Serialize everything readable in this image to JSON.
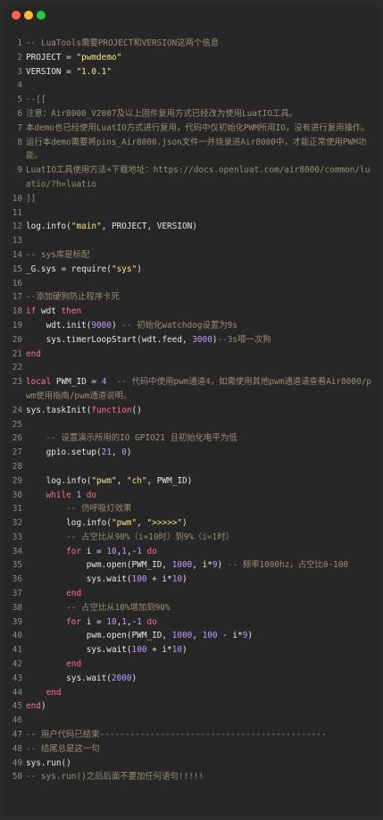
{
  "window": {
    "controls": [
      {
        "name": "close",
        "color": "#ff5f57"
      },
      {
        "name": "minimize",
        "color": "#febc2e"
      },
      {
        "name": "maximize",
        "color": "#28c840"
      }
    ]
  },
  "colors": {
    "keyword": "#ff6e8a",
    "string": "#f1e58a",
    "number": "#bd9cff",
    "comment": "#9a8e72",
    "text": "#e6e6e6",
    "line_number": "#8b8b8b"
  },
  "lines": [
    {
      "n": "1",
      "t": [
        [
          "c",
          "-- LuaTools需要PROJECT和VERSION这两个信息"
        ]
      ]
    },
    {
      "n": "2",
      "t": [
        [
          "",
          "PROJECT = "
        ],
        [
          "s",
          "\"pwmdemo\""
        ]
      ]
    },
    {
      "n": "3",
      "t": [
        [
          "",
          "VERSION = "
        ],
        [
          "s",
          "\"1.0.1\""
        ]
      ]
    },
    {
      "n": "4",
      "t": []
    },
    {
      "n": "5",
      "t": [
        [
          "c",
          "--[["
        ]
      ]
    },
    {
      "n": "6",
      "t": [
        [
          "c",
          "注意：Air8000_V2007及以上固件复用方式已经改为使用LuatIO工具。"
        ]
      ]
    },
    {
      "n": "7",
      "t": [
        [
          "c",
          "本demo也已经使用LuatIO方式进行复用，代码中仅初始化PWM所用IO，没有进行复用操作。"
        ]
      ]
    },
    {
      "n": "8",
      "t": [
        [
          "c",
          "运行本demo需要将pins_Air8000.json文件一并烧录进Air8000中，才能正常使用PWM功能。"
        ]
      ]
    },
    {
      "n": "9",
      "t": [
        [
          "c",
          "LuatIO工具使用方法+下载地址：https://docs.openluat.com/air8000/common/luatio/?h=luatio"
        ]
      ]
    },
    {
      "n": "10",
      "t": [
        [
          "c",
          "]]"
        ]
      ]
    },
    {
      "n": "11",
      "t": []
    },
    {
      "n": "12",
      "t": [
        [
          "",
          "log.info("
        ],
        [
          "s",
          "\"main\""
        ],
        [
          "",
          ", PROJECT, VERSION)"
        ]
      ]
    },
    {
      "n": "13",
      "t": []
    },
    {
      "n": "14",
      "t": [
        [
          "c",
          "-- sys库是标配"
        ]
      ]
    },
    {
      "n": "15",
      "t": [
        [
          "",
          "_G.sys = require("
        ],
        [
          "s",
          "\"sys\""
        ],
        [
          "",
          ")"
        ]
      ]
    },
    {
      "n": "16",
      "t": []
    },
    {
      "n": "17",
      "t": [
        [
          "c",
          "--添加硬狗防止程序卡死"
        ]
      ]
    },
    {
      "n": "18",
      "t": [
        [
          "k",
          "if"
        ],
        [
          "",
          " wdt "
        ],
        [
          "k",
          "then"
        ]
      ]
    },
    {
      "n": "19",
      "t": [
        [
          "",
          "    wdt.init("
        ],
        [
          "n",
          "9000"
        ],
        [
          "",
          ") "
        ],
        [
          "c",
          "-- 初始化watchdog设置为9s"
        ]
      ]
    },
    {
      "n": "20",
      "t": [
        [
          "",
          "    sys.timerLoopStart(wdt.feed, "
        ],
        [
          "n",
          "3000"
        ],
        [
          "",
          ")"
        ],
        [
          "c",
          "--3s喂一次狗"
        ]
      ]
    },
    {
      "n": "21",
      "t": [
        [
          "k",
          "end"
        ]
      ]
    },
    {
      "n": "22",
      "t": []
    },
    {
      "n": "23",
      "t": [
        [
          "k",
          "local"
        ],
        [
          "",
          " PWM_ID = "
        ],
        [
          "n",
          "4"
        ],
        [
          "",
          "  "
        ],
        [
          "c",
          "-- 代码中使用pwm通道4，如需使用其他pwm通道请查看Air8000/pwm使用指南/pwm通道说明。"
        ]
      ]
    },
    {
      "n": "24",
      "t": [
        [
          "",
          "sys.taskInit("
        ],
        [
          "k",
          "function"
        ],
        [
          "",
          "()"
        ]
      ]
    },
    {
      "n": "25",
      "t": []
    },
    {
      "n": "26",
      "t": [
        [
          "",
          "    "
        ],
        [
          "c",
          "-- 设置演示所用的IO GPIO21 且初始化电平为低"
        ]
      ]
    },
    {
      "n": "27",
      "t": [
        [
          "",
          "    gpio.setup("
        ],
        [
          "n",
          "21"
        ],
        [
          "",
          ", "
        ],
        [
          "n",
          "0"
        ],
        [
          "",
          ")"
        ]
      ]
    },
    {
      "n": "28",
      "t": []
    },
    {
      "n": "29",
      "t": [
        [
          "",
          "    log.info("
        ],
        [
          "s",
          "\"pwm\""
        ],
        [
          "",
          ", "
        ],
        [
          "s",
          "\"ch\""
        ],
        [
          "",
          ", PWM_ID)"
        ]
      ]
    },
    {
      "n": "30",
      "t": [
        [
          "",
          "    "
        ],
        [
          "k",
          "while"
        ],
        [
          "",
          " "
        ],
        [
          "n",
          "1"
        ],
        [
          "",
          " "
        ],
        [
          "k",
          "do"
        ]
      ]
    },
    {
      "n": "31",
      "t": [
        [
          "",
          "        "
        ],
        [
          "c",
          "-- 仿呼吸灯效果"
        ]
      ]
    },
    {
      "n": "32",
      "t": [
        [
          "",
          "        log.info("
        ],
        [
          "s",
          "\"pwm\""
        ],
        [
          "",
          ", "
        ],
        [
          "s",
          "\">>>>>\""
        ],
        [
          "",
          ")"
        ]
      ]
    },
    {
      "n": "33",
      "t": [
        [
          "",
          "        "
        ],
        [
          "c",
          "-- 占空比从90%（i=10时）到9%（i=1时）"
        ]
      ]
    },
    {
      "n": "34",
      "t": [
        [
          "",
          "        "
        ],
        [
          "k",
          "for"
        ],
        [
          "",
          " i = "
        ],
        [
          "n",
          "10"
        ],
        [
          "",
          ","
        ],
        [
          "n",
          "1"
        ],
        [
          "",
          ",-"
        ],
        [
          "n",
          "1"
        ],
        [
          "",
          " "
        ],
        [
          "k",
          "do"
        ]
      ]
    },
    {
      "n": "35",
      "t": [
        [
          "",
          "            pwm.open(PWM_ID, "
        ],
        [
          "n",
          "1000"
        ],
        [
          "",
          ", i*"
        ],
        [
          "n",
          "9"
        ],
        [
          "",
          ") "
        ],
        [
          "c",
          "-- 频率1000hz，占空比0-100"
        ]
      ]
    },
    {
      "n": "36",
      "t": [
        [
          "",
          "            sys.wait("
        ],
        [
          "n",
          "100"
        ],
        [
          "",
          " + i*"
        ],
        [
          "n",
          "10"
        ],
        [
          "",
          ")"
        ]
      ]
    },
    {
      "n": "37",
      "t": [
        [
          "",
          "        "
        ],
        [
          "k",
          "end"
        ]
      ]
    },
    {
      "n": "38",
      "t": [
        [
          "",
          "        "
        ],
        [
          "c",
          "-- 占空比从10%增加到90%"
        ]
      ]
    },
    {
      "n": "39",
      "t": [
        [
          "",
          "        "
        ],
        [
          "k",
          "for"
        ],
        [
          "",
          " i = "
        ],
        [
          "n",
          "10"
        ],
        [
          "",
          ","
        ],
        [
          "n",
          "1"
        ],
        [
          "",
          ",-"
        ],
        [
          "n",
          "1"
        ],
        [
          "",
          " "
        ],
        [
          "k",
          "do"
        ]
      ]
    },
    {
      "n": "40",
      "t": [
        [
          "",
          "            pwm.open(PWM_ID, "
        ],
        [
          "n",
          "1000"
        ],
        [
          "",
          ", "
        ],
        [
          "n",
          "100"
        ],
        [
          "",
          " - i*"
        ],
        [
          "n",
          "9"
        ],
        [
          "",
          ")"
        ]
      ]
    },
    {
      "n": "41",
      "t": [
        [
          "",
          "            sys.wait("
        ],
        [
          "n",
          "100"
        ],
        [
          "",
          " + i*"
        ],
        [
          "n",
          "10"
        ],
        [
          "",
          ")"
        ]
      ]
    },
    {
      "n": "42",
      "t": [
        [
          "",
          "        "
        ],
        [
          "k",
          "end"
        ]
      ]
    },
    {
      "n": "43",
      "t": [
        [
          "",
          "        sys.wait("
        ],
        [
          "n",
          "2000"
        ],
        [
          "",
          ")"
        ]
      ]
    },
    {
      "n": "44",
      "t": [
        [
          "",
          "    "
        ],
        [
          "k",
          "end"
        ]
      ]
    },
    {
      "n": "45",
      "t": [
        [
          "k",
          "end"
        ],
        [
          "",
          ")"
        ]
      ]
    },
    {
      "n": "46",
      "t": []
    },
    {
      "n": "47",
      "t": [
        [
          "c",
          "-- 用户代码已结束---------------------------------------------"
        ]
      ]
    },
    {
      "n": "48",
      "t": [
        [
          "c",
          "-- 结尾总是这一句"
        ]
      ]
    },
    {
      "n": "49",
      "t": [
        [
          "",
          "sys.run()"
        ]
      ]
    },
    {
      "n": "50",
      "t": [
        [
          "c",
          "-- sys.run()之后后面不要加任何语句!!!!!"
        ]
      ]
    }
  ]
}
